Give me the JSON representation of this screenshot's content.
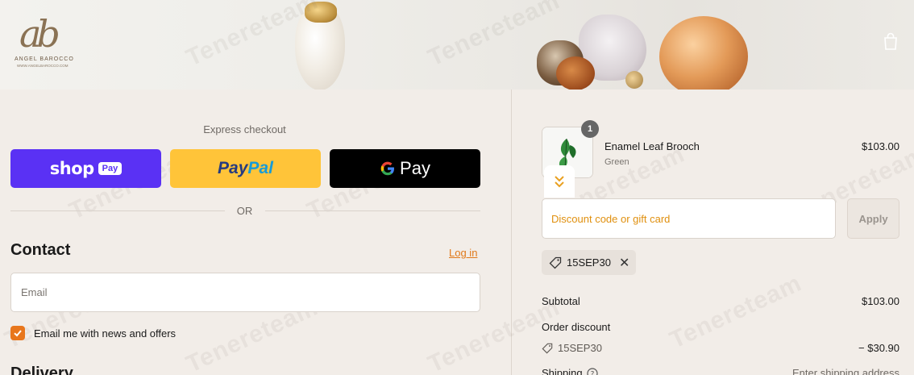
{
  "header": {
    "logo_monogram": "ab",
    "logo_brand": "ANGEL BAROCCO",
    "logo_url": "WWW.ANGELBAROCCO.COM",
    "cart_icon": "shopping-bag-icon"
  },
  "express": {
    "label": "Express checkout",
    "shop_label": "shop",
    "shop_pay_badge": "Pay",
    "paypal_part1": "Pay",
    "paypal_part2": "Pal",
    "gpay_g": "G",
    "gpay_label": "Pay",
    "or_label": "OR"
  },
  "contact": {
    "title": "Contact",
    "login_label": "Log in",
    "email_placeholder": "Email",
    "news_checkbox_checked": true,
    "news_label": "Email me with news and offers"
  },
  "delivery": {
    "title": "Delivery"
  },
  "order": {
    "item": {
      "name": "Enamel Leaf Brooch",
      "variant": "Green",
      "price": "$103.00",
      "quantity": "1"
    },
    "discount_placeholder": "Discount code or gift card",
    "apply_label": "Apply",
    "applied_code": "15SEP30",
    "subtotal_label": "Subtotal",
    "subtotal_value": "$103.00",
    "order_discount_label": "Order discount",
    "order_discount_code": "15SEP30",
    "order_discount_value": "− $30.90",
    "shipping_label": "Shipping",
    "shipping_value": "Enter shipping address"
  },
  "watermark": "Tenereteam",
  "colors": {
    "accent": "#e8761c",
    "shop_pay": "#5a31f4",
    "paypal": "#ffc439",
    "gpay": "#000000"
  }
}
